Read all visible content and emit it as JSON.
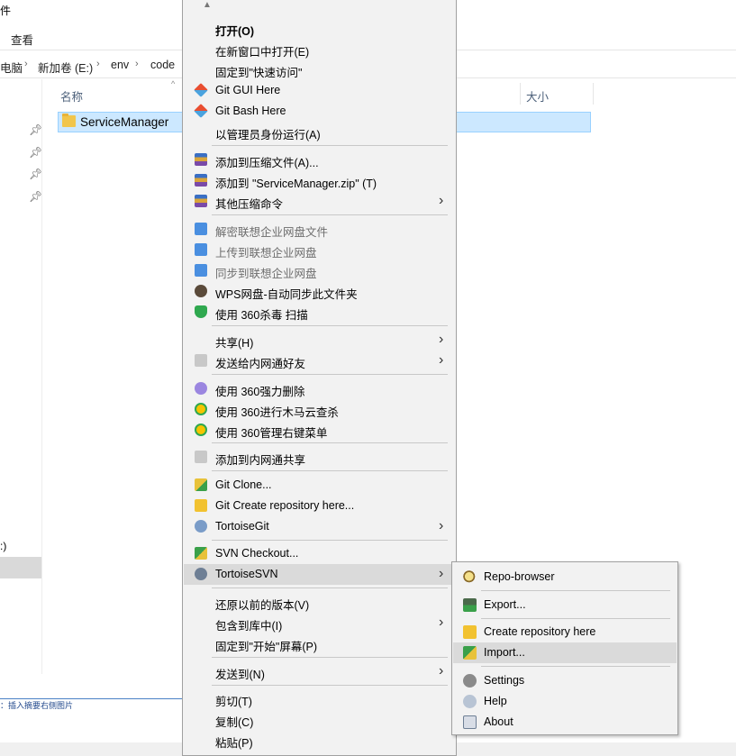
{
  "explorer": {
    "ribbon_partial": "件",
    "view_tab": "查看",
    "breadcrumb": [
      "电脑",
      "新加卷 (E:)",
      "env",
      "code"
    ],
    "columns": {
      "name": "名称",
      "size": "大小"
    },
    "selected_item": "ServiceManager",
    "nav_drive_partial": ":)",
    "status_text": "：插入摘要右侧图片"
  },
  "context_menu": {
    "items": [
      {
        "label": "打开(O)",
        "bold": true,
        "icon": ""
      },
      {
        "label": "在新窗口中打开(E)",
        "icon": ""
      },
      {
        "label": "固定到\"快速访问\"",
        "icon": ""
      },
      {
        "label": "Git GUI Here",
        "icon": "git-icon"
      },
      {
        "label": "Git Bash Here",
        "icon": "git-icon"
      },
      {
        "label": "以管理员身份运行(A)",
        "icon": ""
      },
      {
        "label": "添加到压缩文件(A)...",
        "icon": "archive-icon"
      },
      {
        "label": "添加到 \"ServiceManager.zip\" (T)",
        "icon": "archive-icon"
      },
      {
        "label": "其他压缩命令",
        "icon": "archive-icon",
        "submenu": true
      },
      {
        "label": "解密联想企业网盘文件",
        "icon": "lenovo-cloud-icon",
        "disabled": true
      },
      {
        "label": "上传到联想企业网盘",
        "icon": "lenovo-cloud-icon",
        "disabled": true
      },
      {
        "label": "同步到联想企业网盘",
        "icon": "lenovo-cloud-icon",
        "disabled": true
      },
      {
        "label": "WPS网盘-自动同步此文件夹",
        "icon": "wps-icon"
      },
      {
        "label": "使用 360杀毒 扫描",
        "icon": "360-shield-icon"
      },
      {
        "label": "共享(H)",
        "icon": "",
        "submenu": true
      },
      {
        "label": "发送给内网通好友",
        "icon": "intranet-icon",
        "submenu": true
      },
      {
        "label": "使用 360强力删除",
        "icon": "360-delete-icon"
      },
      {
        "label": "使用 360进行木马云查杀",
        "icon": "360-scan-icon"
      },
      {
        "label": "使用 360管理右键菜单",
        "icon": "360-scan-icon"
      },
      {
        "label": "添加到内网通共享",
        "icon": "intranet-icon"
      },
      {
        "label": "Git Clone...",
        "icon": "git-clone-icon"
      },
      {
        "label": "Git Create repository here...",
        "icon": "git-create-repo-icon"
      },
      {
        "label": "TortoiseGit",
        "icon": "tortoisegit-icon",
        "submenu": true
      },
      {
        "label": "SVN Checkout...",
        "icon": "svn-checkout-icon"
      },
      {
        "label": "TortoiseSVN",
        "icon": "tortoisesvn-icon",
        "submenu": true,
        "highlighted": true
      },
      {
        "label": "还原以前的版本(V)",
        "icon": ""
      },
      {
        "label": "包含到库中(I)",
        "icon": "",
        "submenu": true
      },
      {
        "label": "固定到\"开始\"屏幕(P)",
        "icon": ""
      },
      {
        "label": "发送到(N)",
        "icon": "",
        "submenu": true
      },
      {
        "label": "剪切(T)",
        "icon": ""
      },
      {
        "label": "复制(C)",
        "icon": ""
      },
      {
        "label": "粘贴(P)",
        "icon": ""
      }
    ]
  },
  "svn_submenu": {
    "items": [
      {
        "label": "Repo-browser",
        "icon": "repo-browser-icon"
      },
      {
        "label": "Export...",
        "icon": "export-icon"
      },
      {
        "label": "Create repository here",
        "icon": "create-repo-icon"
      },
      {
        "label": "Import...",
        "icon": "import-icon",
        "highlighted": true
      },
      {
        "label": "Settings",
        "icon": "settings-icon"
      },
      {
        "label": "Help",
        "icon": "help-icon"
      },
      {
        "label": "About",
        "icon": "about-icon"
      }
    ]
  },
  "colors": {
    "selection": "#cce8ff",
    "menu_bg": "#f2f2f2",
    "menu_highlight": "#dadada",
    "disabled_text": "#6d6d6d"
  }
}
